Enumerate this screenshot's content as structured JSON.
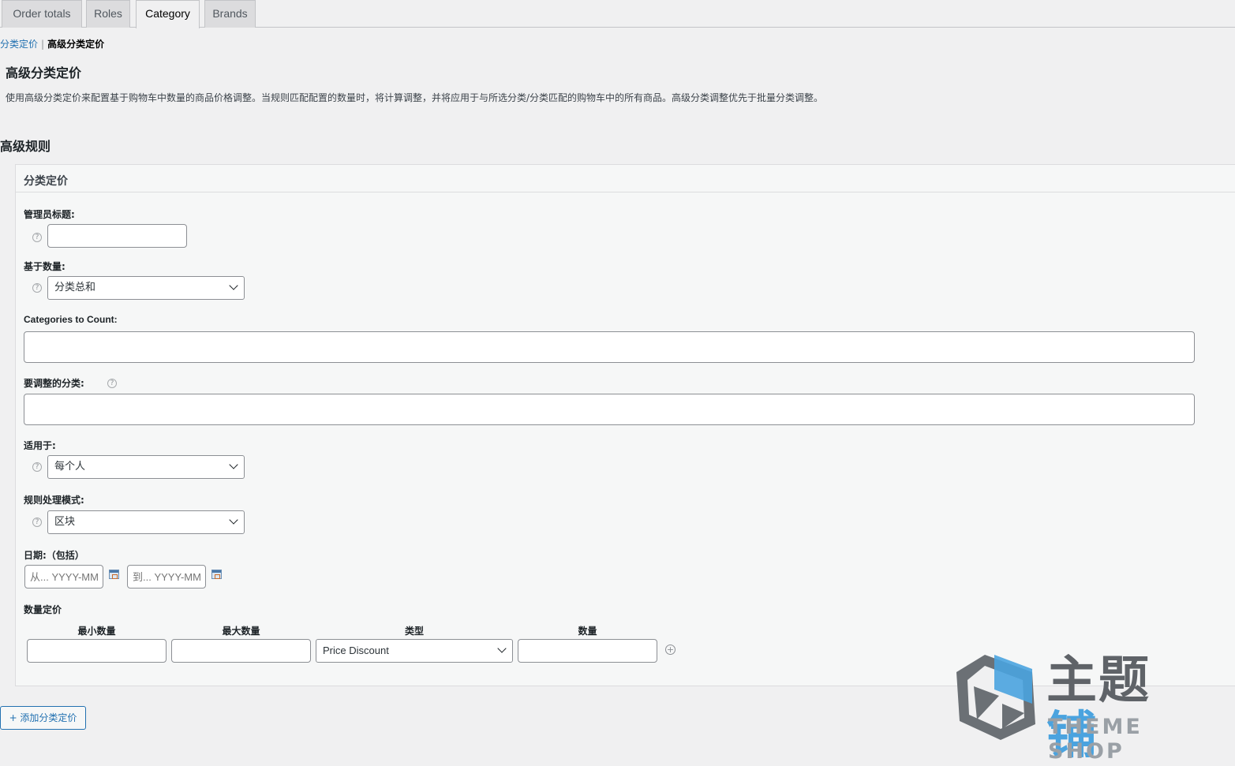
{
  "tabs": [
    {
      "label": "Order totals",
      "active": false
    },
    {
      "label": "Roles",
      "active": false
    },
    {
      "label": "Category",
      "active": true
    },
    {
      "label": "Brands",
      "active": false
    }
  ],
  "breadcrumb": {
    "link": "分类定价",
    "separator": "|",
    "current": "高级分类定价"
  },
  "page": {
    "title": "高级分类定价",
    "description": "使用高级分类定价来配置基于购物车中数量的商品价格调整。当规则匹配配置的数量时，将计算调整，并将应用于与所选分类/分类匹配的购物车中的所有商品。高级分类调整优先于批量分类调整。"
  },
  "section_title": "高级规则",
  "panel": {
    "title": "分类定价",
    "admin_title": {
      "label": "管理员标题:",
      "value": ""
    },
    "based_on": {
      "label": "基于数量:",
      "value": "分类总和"
    },
    "categories_to_count": {
      "label": "Categories to Count:",
      "value": ""
    },
    "categories_to_adjust": {
      "label": "要调整的分类:",
      "value": ""
    },
    "apply_to": {
      "label": "适用于:",
      "value": "每个人"
    },
    "rule_mode": {
      "label": "规则处理模式:",
      "value": "区块"
    },
    "dates": {
      "label": "日期:（包括）",
      "from_placeholder": "从... YYYY-MM-DD",
      "to_placeholder": "到... YYYY-MM-DD"
    },
    "quantity_pricing": {
      "label": "数量定价",
      "columns": [
        "最小数量",
        "最大数量",
        "类型",
        "数量"
      ],
      "row": {
        "min": "",
        "max": "",
        "type": "Price Discount",
        "amount": ""
      }
    },
    "help_glyph": "?",
    "add_row_glyph": "+"
  },
  "add_button": "+ 添加分类定价",
  "watermark": {
    "main": "主题铺",
    "sub": "THEME SHOP",
    "colors": {
      "dark": "#5f6368",
      "blue": "#4aa3df"
    }
  }
}
